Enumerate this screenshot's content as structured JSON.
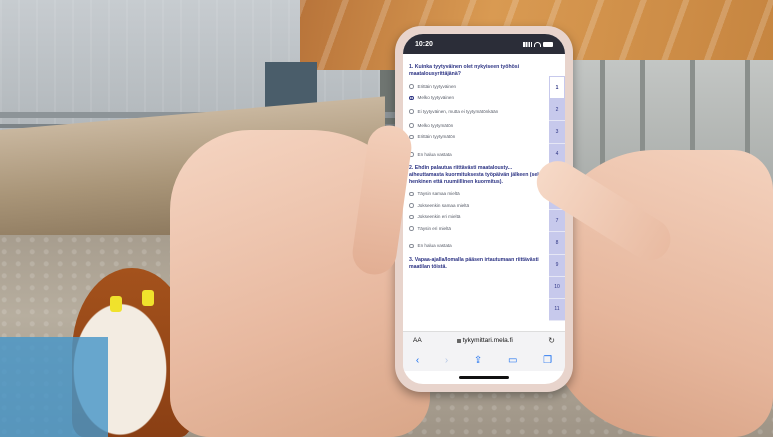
{
  "phone": {
    "time": "10:20",
    "url": "tykymittari.mela.fi",
    "text_size_label": "AA"
  },
  "survey": {
    "questions": [
      {
        "title": "1. Kuinka tyytyväinen olet nykyiseen työhösi maatalousyrittäjänä?",
        "options": [
          "Erittäin tyytyväinen",
          "Melko tyytyväinen",
          "Ei tyytyväinen, mutta ei tyytymätönkään",
          "Melko tyytymätön",
          "Erittäin tyytymätön"
        ],
        "selected": 1,
        "decline": "En halua vastata"
      },
      {
        "title": "2. Ehdin palautua riittävästi maatalousty... aiheuttamasta kuormituksesta työpäivän jälkeen (sekä henkinen että ruumiillinen kuormitus).",
        "options": [
          "Täysin samaa mieltä",
          "Jokseenkin samaa mieltä",
          "Jokseenkin eri mieltä",
          "Täysin eri mieltä"
        ],
        "decline": "En halua vastata"
      },
      {
        "title": "3. Vapaa-ajalla/lomalla pääsen irtautumaan riittävästi maatilan töistä."
      }
    ],
    "nav_numbers": [
      "1",
      "2",
      "3",
      "4",
      "5",
      "6",
      "7",
      "8",
      "9",
      "10",
      "11"
    ],
    "active_nav": "1"
  },
  "colors": {
    "accent": "#2d3484",
    "nav_bg": "#c7c9ec",
    "browser_blue": "#1a6ff0",
    "phone_case": "#e8d4cc"
  }
}
